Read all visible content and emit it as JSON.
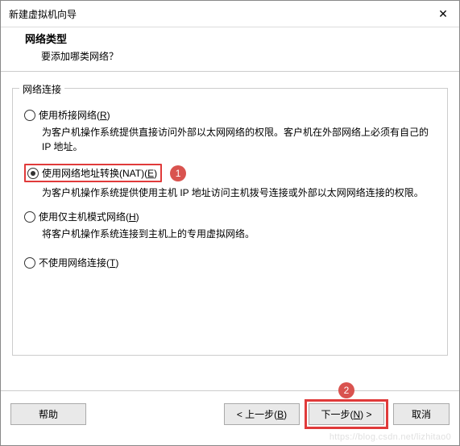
{
  "window": {
    "title": "新建虚拟机向导",
    "close": "✕"
  },
  "header": {
    "title": "网络类型",
    "subtitle": "要添加哪类网络？"
  },
  "fieldset": {
    "legend": "网络连接"
  },
  "options": {
    "bridged": {
      "label_pre": "使用桥接网络(",
      "hotkey": "R",
      "label_post": ")",
      "desc": "为客户机操作系统提供直接访问外部以太网网络的权限。客户机在外部网络上必须有自己的 IP 地址。"
    },
    "nat": {
      "label_pre": "使用网络地址转换(NAT)(",
      "hotkey": "E",
      "label_post": ")",
      "desc": "为客户机操作系统提供使用主机 IP 地址访问主机拨号连接或外部以太网网络连接的权限。"
    },
    "hostonly": {
      "label_pre": "使用仅主机模式网络(",
      "hotkey": "H",
      "label_post": ")",
      "desc": "将客户机操作系统连接到主机上的专用虚拟网络。"
    },
    "none": {
      "label_pre": "不使用网络连接(",
      "hotkey": "T",
      "label_post": ")"
    }
  },
  "callouts": {
    "one": "1",
    "two": "2"
  },
  "buttons": {
    "help": "帮助",
    "back_pre": "< 上一步(",
    "back_hot": "B",
    "back_post": ")",
    "next_pre": "下一步(",
    "next_hot": "N",
    "next_post": ") >",
    "cancel": "取消"
  },
  "watermark": "https://blog.csdn.net/lizhitao0"
}
